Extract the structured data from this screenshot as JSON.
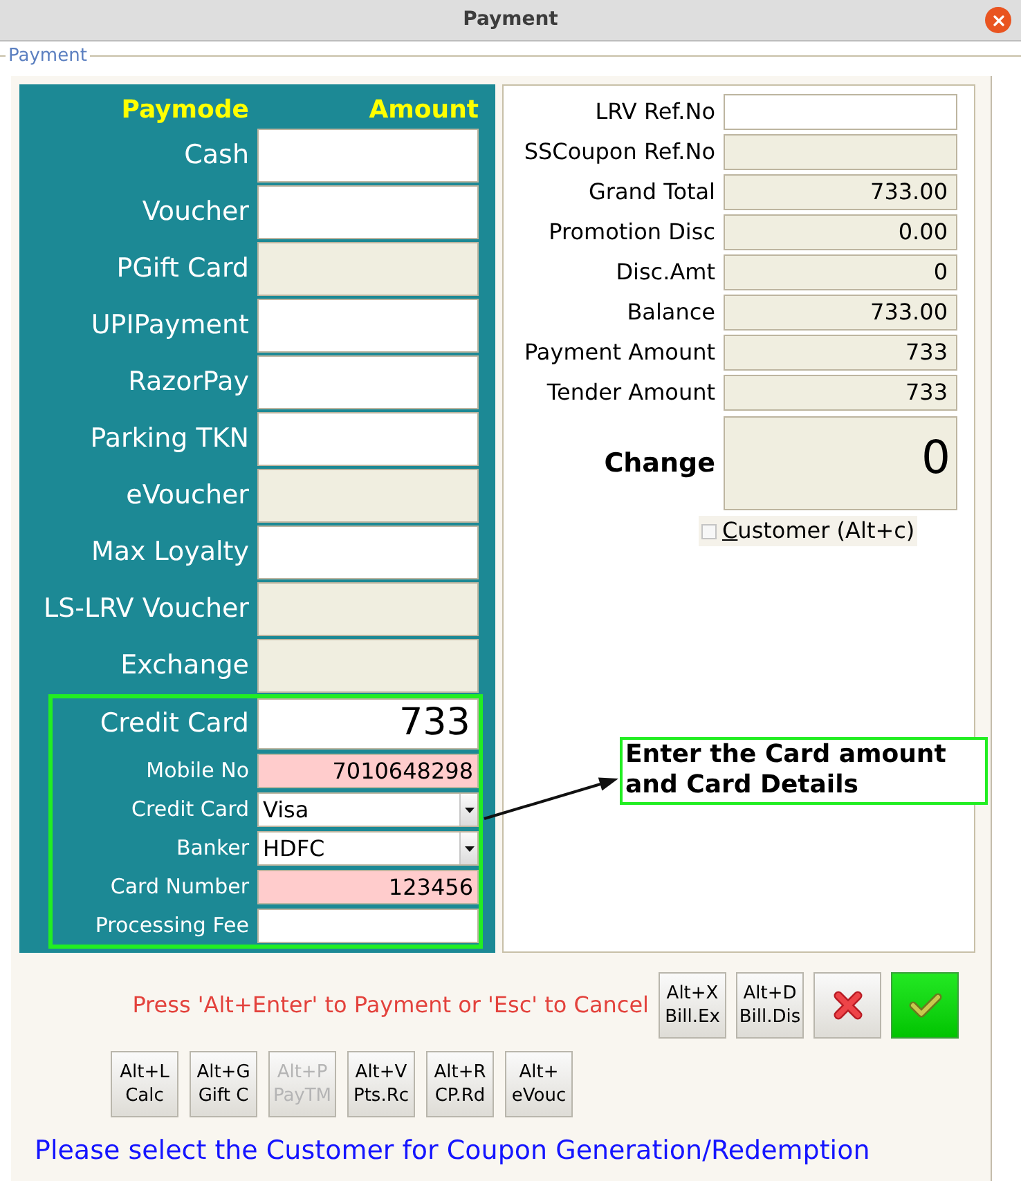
{
  "window": {
    "title": "Payment"
  },
  "group": {
    "legend": "Payment"
  },
  "paymodes": {
    "header": {
      "paymode": "Paymode",
      "amount": "Amount"
    },
    "rows": [
      {
        "label": "Cash",
        "disabled": false
      },
      {
        "label": "Voucher",
        "disabled": false
      },
      {
        "label": "PGift Card",
        "disabled": true
      },
      {
        "label": "UPIPayment",
        "disabled": false
      },
      {
        "label": "RazorPay",
        "disabled": false
      },
      {
        "label": "Parking TKN",
        "disabled": false
      },
      {
        "label": "eVoucher",
        "disabled": true
      },
      {
        "label": "Max Loyalty",
        "disabled": false
      },
      {
        "label": "LS-LRV Voucher",
        "disabled": true
      },
      {
        "label": "Exchange",
        "disabled": true
      }
    ]
  },
  "card_details": {
    "rows": [
      {
        "kind": "amount",
        "label": "Credit Card",
        "value": "733"
      },
      {
        "kind": "text",
        "label": "Mobile No",
        "value": "7010648298",
        "highlighted": true
      },
      {
        "kind": "select",
        "label": "Credit Card",
        "value": "Visa"
      },
      {
        "kind": "select",
        "label": "Banker",
        "value": "HDFC"
      },
      {
        "kind": "text",
        "label": "Card Number",
        "value": "123456",
        "highlighted": true
      },
      {
        "kind": "text",
        "label": "Processing Fee",
        "highlighted": false
      }
    ]
  },
  "summary": {
    "rows": [
      {
        "label": "LRV Ref.No",
        "disabled": false
      },
      {
        "label": "SSCoupon Ref.No",
        "disabled": true
      },
      {
        "label": "Grand Total",
        "value": "733.00",
        "disabled": true
      },
      {
        "label": "Promotion Disc",
        "value": "0.00",
        "disabled": true
      },
      {
        "label": "Disc.Amt",
        "value": "0",
        "disabled": true
      },
      {
        "label": "Balance",
        "value": "733.00",
        "disabled": true
      },
      {
        "label": "Payment Amount",
        "value": "733",
        "disabled": true
      },
      {
        "label": "Tender Amount",
        "value": "733",
        "disabled": true
      }
    ],
    "change": {
      "label": "Change",
      "value": "0"
    },
    "customer_checkbox": {
      "label": "Customer (Alt+c)",
      "checked": false
    }
  },
  "annotation": {
    "text": "Enter the Card amount and Card Details"
  },
  "hint": "Press 'Alt+Enter' to Payment or 'Esc' to Cancel",
  "action_buttons": [
    {
      "kind": "shortcut",
      "shortcut": "Alt+X",
      "label": "Bill.Ex"
    },
    {
      "kind": "shortcut",
      "shortcut": "Alt+D",
      "label": "Bill.Dis"
    },
    {
      "kind": "cancel"
    },
    {
      "kind": "confirm"
    }
  ],
  "shortcut_buttons": [
    {
      "shortcut": "Alt+L",
      "label": "Calc",
      "disabled": false
    },
    {
      "shortcut": "Alt+G",
      "label": "Gift C",
      "disabled": false
    },
    {
      "shortcut": "Alt+P",
      "label": "PayTM",
      "disabled": true
    },
    {
      "shortcut": "Alt+V",
      "label": "Pts.Rc",
      "disabled": false
    },
    {
      "shortcut": "Alt+R",
      "label": "CP.Rd",
      "disabled": false
    },
    {
      "shortcut": "Alt+",
      "label": "eVouc",
      "disabled": false
    }
  ],
  "status_message": "Please select the Customer for Coupon Generation/Redemption"
}
